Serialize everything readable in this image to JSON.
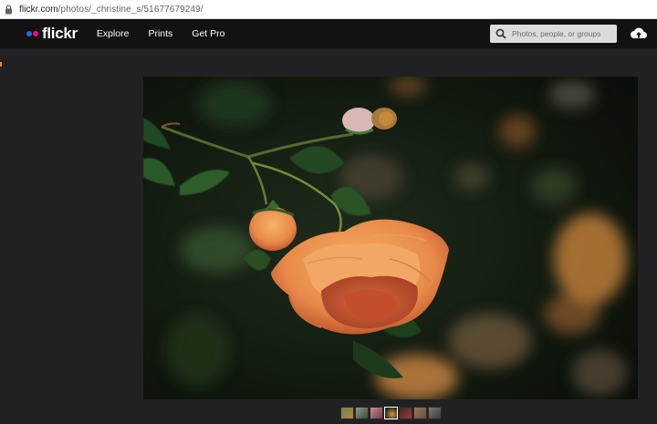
{
  "browser": {
    "url_host": "flickr.com",
    "url_path": "/photos/_christine_s/51677679249/"
  },
  "nav": {
    "logo_text": "flickr",
    "menu": [
      {
        "label": "Explore"
      },
      {
        "label": "Prints"
      },
      {
        "label": "Get Pro"
      }
    ],
    "search_placeholder": "Photos, people, or groups"
  },
  "colors": {
    "flickr_blue": "#1f6fe0",
    "flickr_pink": "#ff0084",
    "nav_bg": "#121212",
    "page_bg": "#212124"
  },
  "photo": {
    "subject": "orange rose"
  },
  "thumbnails": {
    "count": 7,
    "active_index": 3
  }
}
